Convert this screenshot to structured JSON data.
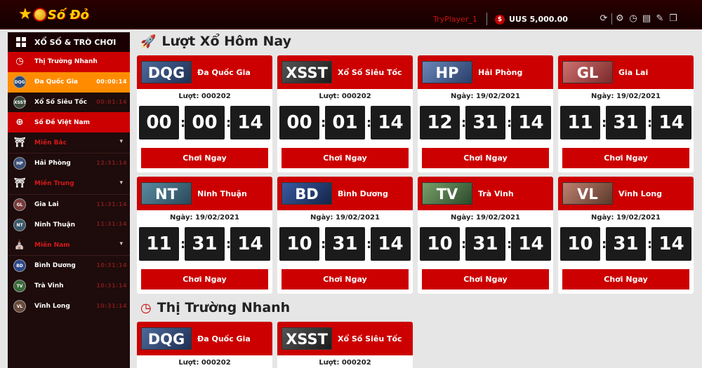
{
  "header": {
    "logo_text": "Số Đỏ",
    "username": "TryPlayer_1",
    "coin_symbol": "$",
    "balance": "UUS 5,000.00",
    "tools": [
      "refresh-icon",
      "settings-icon",
      "history-icon",
      "document-icon",
      "notes-icon",
      "book-icon"
    ]
  },
  "sidebar": {
    "title": "XỔ SỐ & TRÒ CHƠI",
    "items": [
      {
        "label": "Thị Trường Nhanh",
        "type": "section",
        "icon": "clock"
      },
      {
        "label": "Đa Quốc Gia",
        "code": "DQG",
        "time": "00:00:14",
        "active": true
      },
      {
        "label": "Xổ Số Siêu Tốc",
        "code": "XSST",
        "time": "00:01:14"
      },
      {
        "label": "Số Đề Việt Nam",
        "type": "section",
        "icon": "globe"
      },
      {
        "label": "Miền Bắc",
        "type": "region"
      },
      {
        "label": "Hải Phòng",
        "code": "HP",
        "time": "12:31:14"
      },
      {
        "label": "Miền Trung",
        "type": "region"
      },
      {
        "label": "Gia Lai",
        "code": "GL",
        "time": "11:31:14"
      },
      {
        "label": "Ninh Thuận",
        "code": "NT",
        "time": "11:31:14"
      },
      {
        "label": "Miền Nam",
        "type": "region"
      },
      {
        "label": "Bình Dương",
        "code": "BD",
        "time": "10:31:14"
      },
      {
        "label": "Trà Vinh",
        "code": "TV",
        "time": "10:31:14"
      },
      {
        "label": "Vĩnh Long",
        "code": "VL",
        "time": "10:31:14"
      }
    ]
  },
  "today": {
    "title": "Lượt Xổ Hôm Nay",
    "cards": [
      {
        "code": "DQG",
        "name": "Đa Quốc Gia",
        "info": "Lượt: 000202",
        "h": "00",
        "m": "00",
        "s": "14",
        "button": "Chơi Ngay"
      },
      {
        "code": "XSST",
        "name": "Xổ Số Siêu Tốc",
        "info": "Lượt: 000202",
        "h": "00",
        "m": "01",
        "s": "14",
        "button": "Chơi Ngay"
      },
      {
        "code": "HP",
        "name": "Hải Phòng",
        "info": "Ngày: 19/02/2021",
        "h": "12",
        "m": "31",
        "s": "14",
        "button": "Chơi Ngay"
      },
      {
        "code": "GL",
        "name": "Gia Lai",
        "info": "Ngày: 19/02/2021",
        "h": "11",
        "m": "31",
        "s": "14",
        "button": "Chơi Ngay"
      },
      {
        "code": "NT",
        "name": "Ninh Thuận",
        "info": "Ngày: 19/02/2021",
        "h": "11",
        "m": "31",
        "s": "14",
        "button": "Chơi Ngay"
      },
      {
        "code": "BD",
        "name": "Bình Dương",
        "info": "Ngày: 19/02/2021",
        "h": "10",
        "m": "31",
        "s": "14",
        "button": "Chơi Ngay"
      },
      {
        "code": "TV",
        "name": "Trà Vinh",
        "info": "Ngày: 19/02/2021",
        "h": "10",
        "m": "31",
        "s": "14",
        "button": "Chơi Ngay"
      },
      {
        "code": "VL",
        "name": "Vĩnh Long",
        "info": "Ngày: 19/02/2021",
        "h": "10",
        "m": "31",
        "s": "14",
        "button": "Chơi Ngay"
      }
    ]
  },
  "fast": {
    "title": "Thị Trường Nhanh",
    "cards": [
      {
        "code": "DQG",
        "name": "Đa Quốc Gia",
        "info": "Lượt: 000202"
      },
      {
        "code": "XSST",
        "name": "Xổ Số Siêu Tốc",
        "info": "Lượt: 000202"
      }
    ]
  },
  "colors": {
    "accent": "#cc0000",
    "active": "#ff8c00",
    "sidebar": "#1e0b0b",
    "digit_bg": "#1b1b1b"
  }
}
